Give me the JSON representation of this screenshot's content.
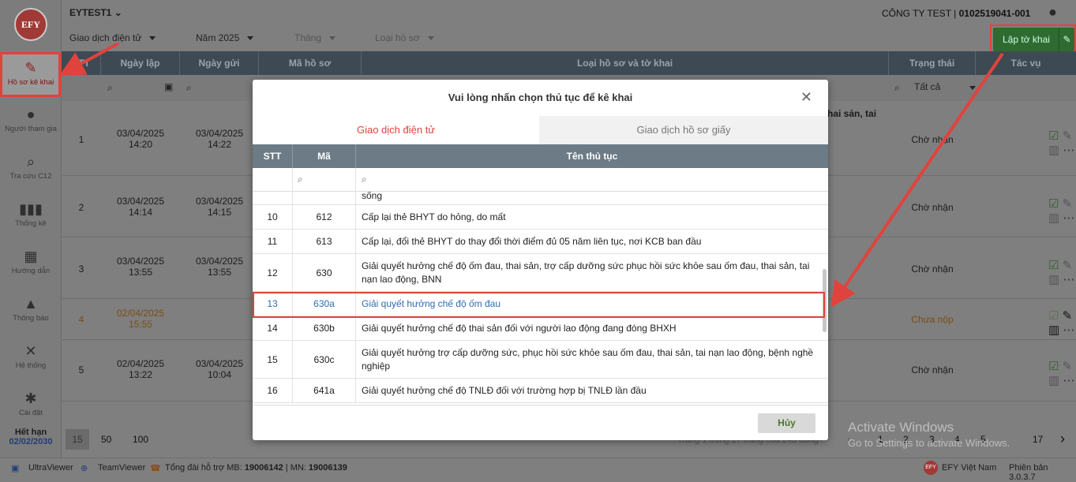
{
  "app": {
    "logo_text": "EFY"
  },
  "header": {
    "account": "EYTEST1",
    "company": "CÔNG TY TEST | ",
    "tax_code": "0102519041-001"
  },
  "filters": {
    "type": "Giao dịch điện tử",
    "year": "Năm 2025",
    "month": "Tháng",
    "record_type": "Loại hồ sơ"
  },
  "create_button": "Lập tờ khai",
  "sidebar": {
    "items": [
      {
        "label": "Hồ sơ kê khai",
        "icon": "document-edit-icon"
      },
      {
        "label": "Người tham gia",
        "icon": "user-icon"
      },
      {
        "label": "Tra cứu C12",
        "icon": "search-icon"
      },
      {
        "label": "Thống kê",
        "icon": "bar-chart-icon"
      },
      {
        "label": "Hướng dẫn",
        "icon": "book-icon"
      },
      {
        "label": "Thông báo",
        "icon": "bell-icon"
      },
      {
        "label": "Hệ thống",
        "icon": "tools-icon"
      },
      {
        "label": "Cài đặt",
        "icon": "gear-icon"
      }
    ],
    "expiry_label": "Hết hạn",
    "expiry_date": "02/02/2030"
  },
  "table": {
    "columns": [
      "STT",
      "Ngày lập",
      "Ngày gửi",
      "Mã hồ sơ",
      "Loại hồ sơ và tờ khai",
      "Trạng thái",
      "Tác vụ"
    ],
    "status_filter": "Tất cả",
    "partial_text": "hai sản, tai",
    "rows": [
      {
        "stt": "1",
        "created": "03/04/2025",
        "created_time": "14:20",
        "sent": "03/04/2025",
        "sent_time": "14:22",
        "status": "Chờ nhận"
      },
      {
        "stt": "2",
        "created": "03/04/2025",
        "created_time": "14:14",
        "sent": "03/04/2025",
        "sent_time": "14:15",
        "status": "Chờ nhận"
      },
      {
        "stt": "3",
        "created": "03/04/2025",
        "created_time": "13:55",
        "sent": "03/04/2025",
        "sent_time": "13:55",
        "status": "Chờ nhận"
      },
      {
        "stt": "4",
        "created": "02/04/2025",
        "created_time": "15:55",
        "sent": "",
        "sent_time": "",
        "status": "Chưa nộp"
      },
      {
        "stt": "5",
        "created": "02/04/2025",
        "created_time": "13:22",
        "sent": "03/04/2025",
        "sent_time": "10:04",
        "status": "Chờ nhận"
      }
    ]
  },
  "pagination": {
    "sizes": [
      "15",
      "50",
      "100"
    ],
    "info": "Trang 1 trong 17 trang của 248 dòng",
    "pages": [
      "1",
      "2",
      "3",
      "4",
      "5",
      "17"
    ]
  },
  "footer": {
    "ultraviewer": "UltraViewer",
    "teamviewer": "TeamViewer",
    "support": "Tổng đài hỗ trợ MB: ",
    "mb": "19006142",
    "mn_label": " | MN: ",
    "mn": "19006139",
    "brand": "EFY Việt Nam",
    "version": "Phiên bản 3.0.3.7"
  },
  "watermark": {
    "line1": "Activate Windows",
    "line2": "Go to Settings to activate Windows."
  },
  "modal": {
    "title": "Vui lòng nhấn chọn thủ tục để kê khai",
    "tabs": [
      "Giao dịch điện tử",
      "Giao dịch hồ sơ giấy"
    ],
    "columns": [
      "STT",
      "Mã",
      "Tên thủ tục"
    ],
    "partial_row": "sống",
    "rows": [
      {
        "stt": "10",
        "code": "612",
        "name": "Cấp lại thẻ BHYT do hỏng, do mất"
      },
      {
        "stt": "11",
        "code": "613",
        "name": "Cấp lại, đổi thẻ BHYT do thay đổi thời điểm đủ 05 năm liên tục, nơi KCB ban đầu"
      },
      {
        "stt": "12",
        "code": "630",
        "name": "Giải quyết hưởng chế độ ốm đau, thai sản, trợ cấp dưỡng sức phục hồi sức khỏe sau ốm đau, thai sản, tai nạn lao động, BNN"
      },
      {
        "stt": "13",
        "code": "630a",
        "name": "Giải quyết hưởng chế độ ốm đau"
      },
      {
        "stt": "14",
        "code": "630b",
        "name": "Giải quyết hưởng chế độ thai sản đối với người lao động đang đóng BHXH"
      },
      {
        "stt": "15",
        "code": "630c",
        "name": "Giải quyết hưởng trợ cấp dưỡng sức, phục hồi sức khỏe sau ốm đau, thai sản, tai nạn lao động, bệnh nghề nghiệp"
      },
      {
        "stt": "16",
        "code": "641a",
        "name": "Giải quyết hưởng chế độ TNLĐ đối với trường hợp bị TNLĐ lần đầu"
      }
    ],
    "cancel": "Hủy"
  },
  "colors": {
    "accent": "#e0433d",
    "selected": "#2f6db3",
    "primary": "#2e7d32"
  }
}
